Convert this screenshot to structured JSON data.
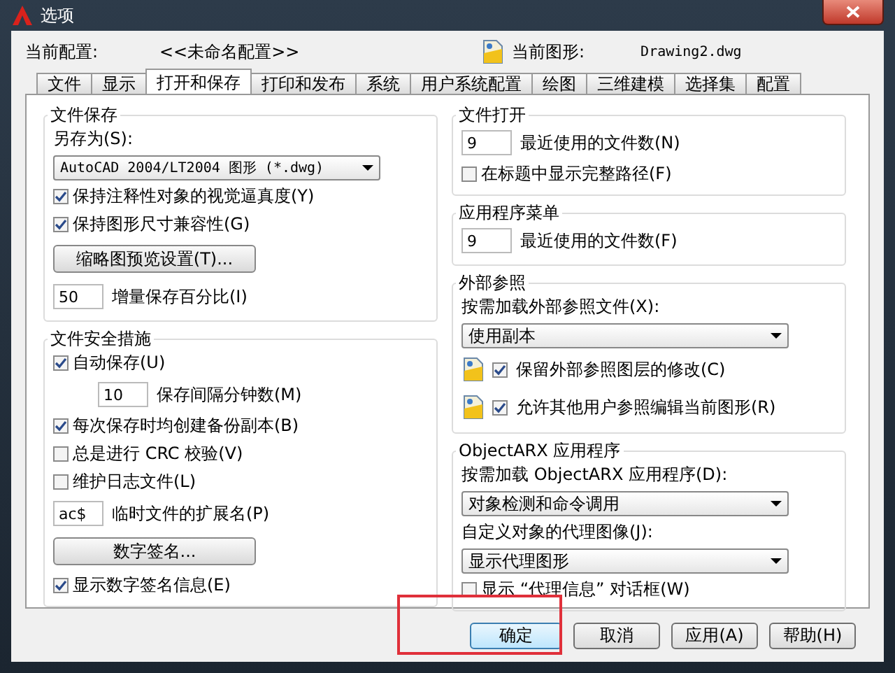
{
  "window": {
    "title": "选项"
  },
  "header": {
    "profile_label": "当前配置:",
    "profile_value": "<<未命名配置>>",
    "drawing_label": "当前图形:",
    "drawing_value": "Drawing2.dwg"
  },
  "tabs": [
    {
      "label": "文件",
      "selected": false
    },
    {
      "label": "显示",
      "selected": false
    },
    {
      "label": "打开和保存",
      "selected": true
    },
    {
      "label": "打印和发布",
      "selected": false
    },
    {
      "label": "系统",
      "selected": false
    },
    {
      "label": "用户系统配置",
      "selected": false
    },
    {
      "label": "绘图",
      "selected": false
    },
    {
      "label": "三维建模",
      "selected": false
    },
    {
      "label": "选择集",
      "selected": false
    },
    {
      "label": "配置",
      "selected": false
    }
  ],
  "left_groups": [
    {
      "title": "文件保存",
      "items": [
        {
          "kind": "label",
          "text": "另存为(S):"
        },
        {
          "kind": "dropdown",
          "value": "AutoCAD 2004/LT2004 图形 (*.dwg)"
        },
        {
          "kind": "checkbox",
          "label": "保持注释性对象的视觉逼真度(Y)",
          "checked": true
        },
        {
          "kind": "checkbox",
          "label": "保持图形尺寸兼容性(G)",
          "checked": true
        },
        {
          "kind": "button",
          "label": "缩略图预览设置(T)..."
        },
        {
          "kind": "field",
          "value": "50",
          "label": "增量保存百分比(I)",
          "indented": false
        }
      ]
    },
    {
      "title": "文件安全措施",
      "items": [
        {
          "kind": "checkbox",
          "label": "自动保存(U)",
          "checked": true
        },
        {
          "kind": "field",
          "value": "10",
          "label": "保存间隔分钟数(M)",
          "indented": true
        },
        {
          "kind": "checkbox",
          "label": "每次保存时均创建备份副本(B)",
          "checked": true
        },
        {
          "kind": "checkbox",
          "label": "总是进行 CRC 校验(V)",
          "checked": false
        },
        {
          "kind": "checkbox",
          "label": "维护日志文件(L)",
          "checked": false
        },
        {
          "kind": "field",
          "value": "ac$",
          "label": "临时文件的扩展名(P)",
          "indented": false
        },
        {
          "kind": "button",
          "label": "数字签名..."
        },
        {
          "kind": "checkbox",
          "label": "显示数字签名信息(E)",
          "checked": true
        }
      ]
    }
  ],
  "right_groups": [
    {
      "title": "文件打开",
      "items": [
        {
          "kind": "field",
          "value": "9",
          "label": "最近使用的文件数(N)",
          "indented": false
        },
        {
          "kind": "checkbox",
          "label": "在标题中显示完整路径(F)",
          "checked": false
        }
      ]
    },
    {
      "title": "应用程序菜单",
      "items": [
        {
          "kind": "field",
          "value": "9",
          "label": "最近使用的文件数(F)",
          "indented": false
        }
      ]
    },
    {
      "title": "外部参照",
      "items": [
        {
          "kind": "label",
          "text": "按需加载外部参照文件(X):"
        },
        {
          "kind": "dropdown",
          "value": "使用副本"
        },
        {
          "kind": "icon_checkbox",
          "label": "保留外部参照图层的修改(C)",
          "checked": true
        },
        {
          "kind": "icon_checkbox",
          "label": "允许其他用户参照编辑当前图形(R)",
          "checked": true
        }
      ]
    },
    {
      "title": "ObjectARX 应用程序",
      "items": [
        {
          "kind": "label",
          "text": "按需加载 ObjectARX 应用程序(D):"
        },
        {
          "kind": "dropdown",
          "value": "对象检测和命令调用"
        },
        {
          "kind": "label",
          "text": "自定义对象的代理图像(J):"
        },
        {
          "kind": "dropdown",
          "value": "显示代理图形"
        },
        {
          "kind": "checkbox",
          "label": "显示 “代理信息” 对话框(W)",
          "checked": false
        }
      ]
    }
  ],
  "buttons": [
    {
      "label": "确定",
      "highlighted": true
    },
    {
      "label": "取消",
      "highlighted": false
    },
    {
      "label": "应用(A)",
      "highlighted": false
    },
    {
      "label": "帮助(H)",
      "highlighted": false
    }
  ]
}
